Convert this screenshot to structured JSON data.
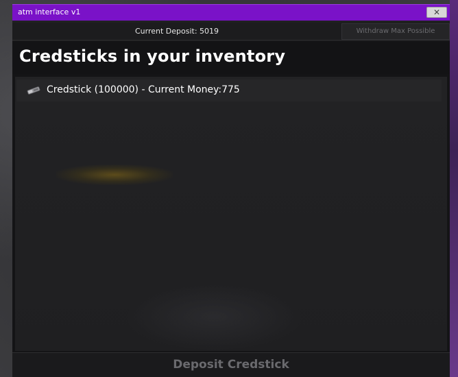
{
  "window": {
    "title": "atm interface v1",
    "close_label": "✕"
  },
  "infobar": {
    "deposit_text": "Current Deposit: 5019",
    "withdraw_label": "Withdraw Max Possible"
  },
  "content": {
    "heading": "Credsticks in your inventory",
    "items": [
      {
        "label": "Credstick (100000) - Current Money:775",
        "icon": "credstick-icon"
      }
    ]
  },
  "footer": {
    "deposit_label": "Deposit Credstick"
  },
  "colors": {
    "titlebar": "#7a12c8",
    "panel": "#141416",
    "disabled_text": "#6a6a6e"
  }
}
